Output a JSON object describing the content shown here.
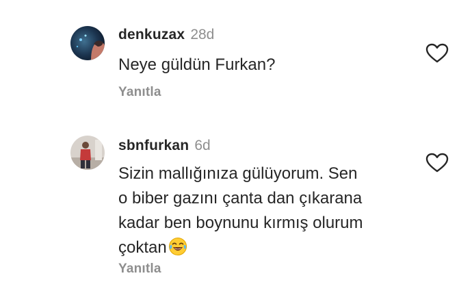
{
  "comments": [
    {
      "username": "denkuzax",
      "time": "28d",
      "text": "Neye güldün Furkan?",
      "reply_label": "Yanıtla",
      "avatar_icon": "profile-avatar-icon",
      "like_icon": "heart-outline-icon"
    },
    {
      "username": "sbnfurkan",
      "time": "6d",
      "text_lines": [
        "Sizin mallığınıza gülüyorum. Sen",
        "o biber gazını çanta dan çıkarana",
        "kadar ben boynunu kırmış olurum",
        "çoktan"
      ],
      "emoji": "face-with-tears-of-joy-emoji",
      "reply_label": "Yanıtla",
      "avatar_icon": "profile-avatar-icon",
      "like_icon": "heart-outline-icon"
    }
  ],
  "colors": {
    "text": "#262626",
    "secondary": "#8e8e8e",
    "background": "#ffffff"
  }
}
